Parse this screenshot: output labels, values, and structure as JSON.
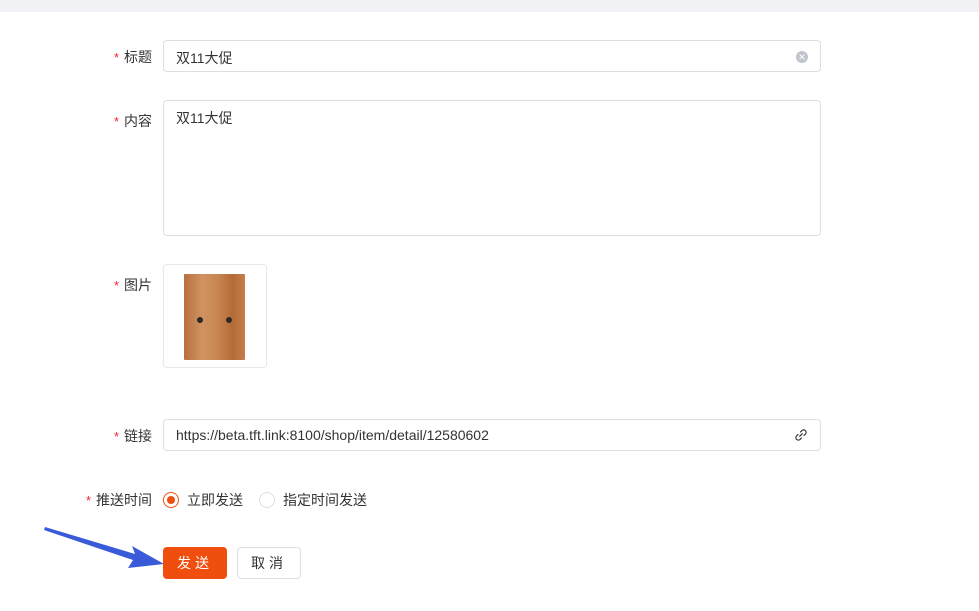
{
  "form": {
    "required_mark": "*",
    "title": {
      "label": "标题",
      "value": "双11大促"
    },
    "content": {
      "label": "内容",
      "value": "双11大促"
    },
    "image": {
      "label": "图片"
    },
    "link": {
      "label": "链接",
      "value": "https://beta.tft.link:8100/shop/item/detail/12580602"
    },
    "push_time": {
      "label": "推送时间",
      "options": [
        {
          "label": "立即发送",
          "checked": true
        },
        {
          "label": "指定时间发送",
          "checked": false
        }
      ]
    }
  },
  "actions": {
    "send_label": "发送",
    "cancel_label": "取消"
  },
  "colors": {
    "accent": "#f04e0f",
    "required": "#f5222d",
    "annotation_arrow": "#3a5bd9"
  },
  "icons": {
    "clear": "close-circle-icon",
    "link": "link-icon"
  }
}
